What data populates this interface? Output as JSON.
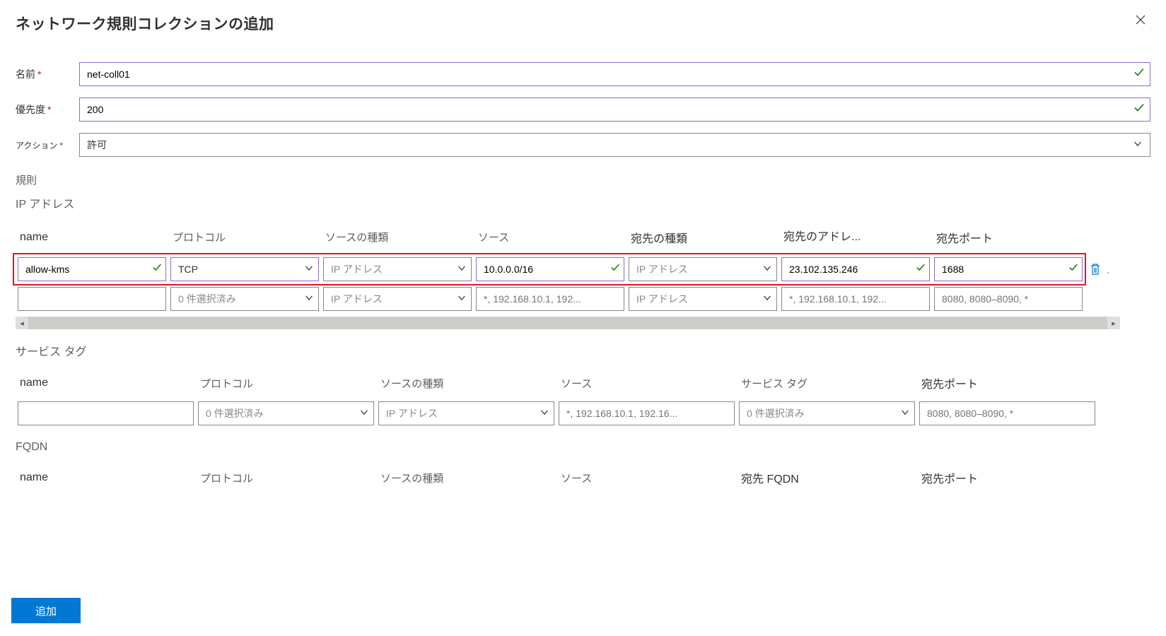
{
  "header": {
    "title": "ネットワーク規則コレクションの追加"
  },
  "form": {
    "name_label": "名前",
    "name_value": "net-coll01",
    "priority_label": "優先度",
    "priority_value": "200",
    "action_label": "アクション",
    "action_value": "許可"
  },
  "rules_section_label": "規則",
  "ip": {
    "heading": "IP アドレス",
    "cols": {
      "name": "name",
      "protocol": "プロトコル",
      "source_type": "ソースの種類",
      "source": "ソース",
      "dest_type": "宛先の種類",
      "dest_addr": "宛先のアドレ...",
      "dest_port": "宛先ポート"
    },
    "row1": {
      "name": "allow-kms",
      "protocol": "TCP",
      "source_type": "IP アドレス",
      "source": "10.0.0.0/16",
      "dest_type": "IP アドレス",
      "dest_addr": "23.102.135.246",
      "dest_port": "1688"
    },
    "row2": {
      "name": "",
      "protocol_placeholder": "0 件選択済み",
      "source_type_placeholder": "IP アドレス",
      "source_placeholder": "*, 192.168.10.1, 192...",
      "dest_type_placeholder": "IP アドレス",
      "dest_addr_placeholder": "*, 192.168.10.1, 192...",
      "dest_port_placeholder": "8080, 8080–8090, *"
    }
  },
  "svctag": {
    "heading": "サービス タグ",
    "cols": {
      "name": "name",
      "protocol": "プロトコル",
      "source_type": "ソースの種類",
      "source": "ソース",
      "service_tag": "サービス タグ",
      "dest_port": "宛先ポート"
    },
    "row": {
      "name": "",
      "protocol_placeholder": "0 件選択済み",
      "source_type_placeholder": "IP アドレス",
      "source_placeholder": "*, 192.168.10.1, 192.16...",
      "service_tag_placeholder": "0 件選択済み",
      "dest_port_placeholder": "8080, 8080–8090, *"
    }
  },
  "fqdn": {
    "heading": "FQDN",
    "cols": {
      "name": "name",
      "protocol": "プロトコル",
      "source_type": "ソースの種類",
      "source": "ソース",
      "dest_fqdn": "宛先 FQDN",
      "dest_port": "宛先ポート"
    }
  },
  "footer": {
    "add_label": "追加"
  }
}
